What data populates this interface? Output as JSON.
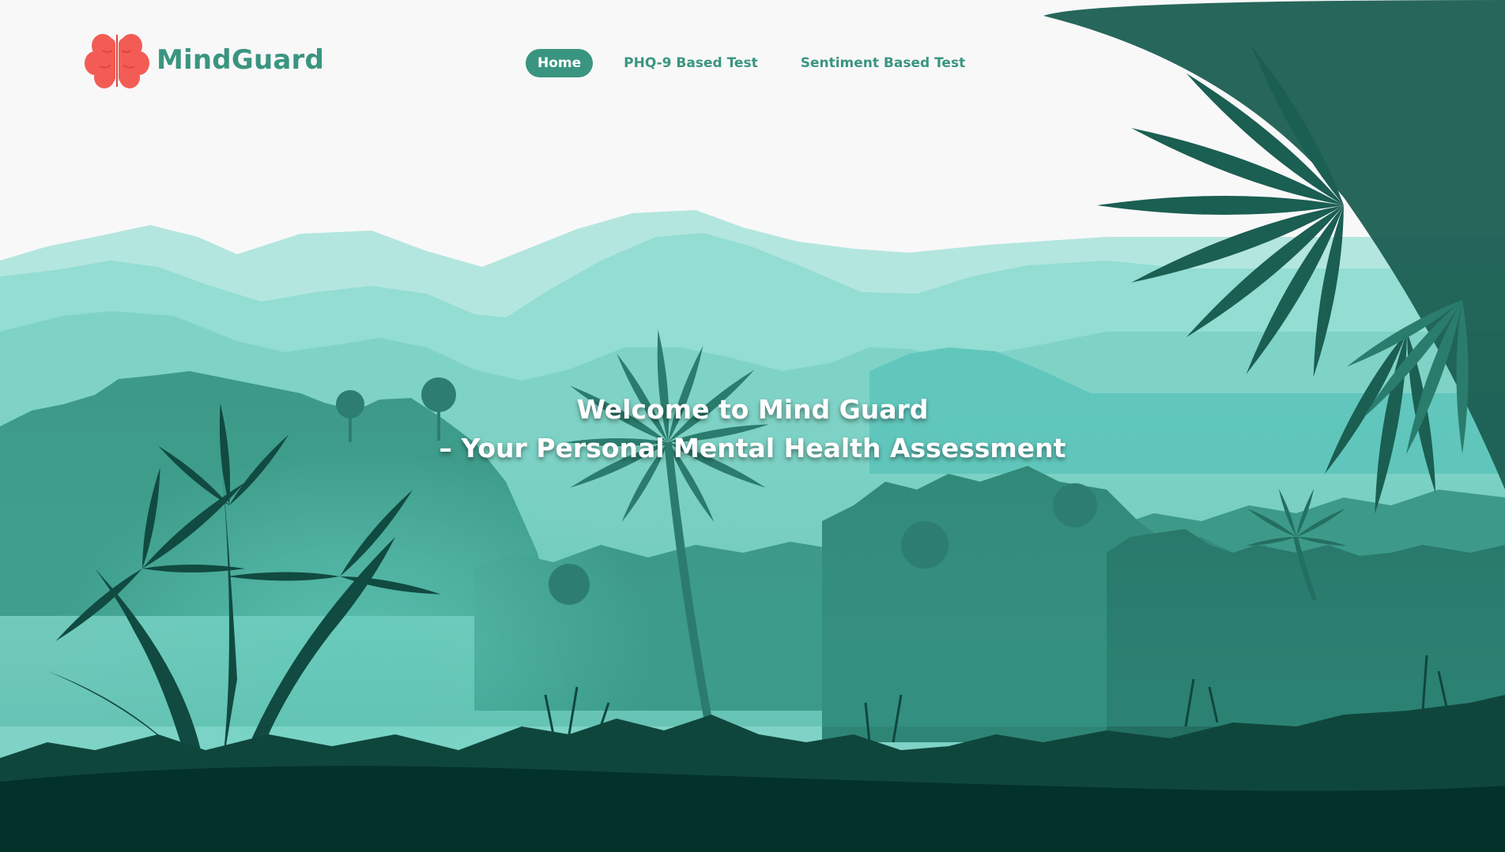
{
  "app": {
    "brand": "MindGuard",
    "logo_icon": "brain-icon",
    "colors": {
      "accent": "#3a9580",
      "logo_red": "#f25c54",
      "sky": "#f8f8f8",
      "forest_dark": "#03322a"
    }
  },
  "nav": {
    "items": [
      {
        "label": "Home",
        "active": true
      },
      {
        "label": "PHQ-9 Based Test",
        "active": false
      },
      {
        "label": "Sentiment Based Test",
        "active": false
      }
    ]
  },
  "hero": {
    "line1": "Welcome to Mind Guard",
    "line2": "– Your Personal Mental Health Assessment"
  }
}
